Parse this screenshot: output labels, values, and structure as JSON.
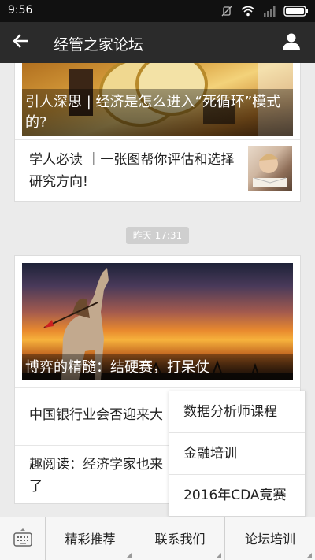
{
  "status_bar": {
    "time": "9:56",
    "icons": [
      "mute-icon",
      "wifi-icon",
      "signal-icon",
      "battery-icon"
    ]
  },
  "title_bar": {
    "title": "经管之家论坛",
    "back_icon": "arrow-left-icon",
    "profile_icon": "person-icon"
  },
  "feed": {
    "card1": {
      "cover_caption": "引人深思 | 经济是怎么进入“死循环”模式的?",
      "articles": [
        {
          "title": "学人必读 ｜一张图帮你评估和选择研究方向!",
          "has_thumb": true
        }
      ]
    },
    "timestamp": "昨天 17:31",
    "card2": {
      "cover_caption": "博弈的精髓：结硬赛，打呆仗",
      "articles": [
        {
          "title": "中国银行业会否迎来大"
        },
        {
          "title": "趣阅读：经济学家也来了"
        }
      ]
    }
  },
  "popup_menu": {
    "items": [
      "数据分析师课程",
      "金融培训",
      "2016年CDA竞赛"
    ]
  },
  "bottom_menu": {
    "keyboard_icon": "keyboard-icon",
    "buttons": [
      "精彩推荐",
      "联系我们",
      "论坛培训"
    ]
  },
  "colors": {
    "title_bar": "#2b2b2b",
    "status_bar": "#111111",
    "background": "#ebebeb"
  }
}
